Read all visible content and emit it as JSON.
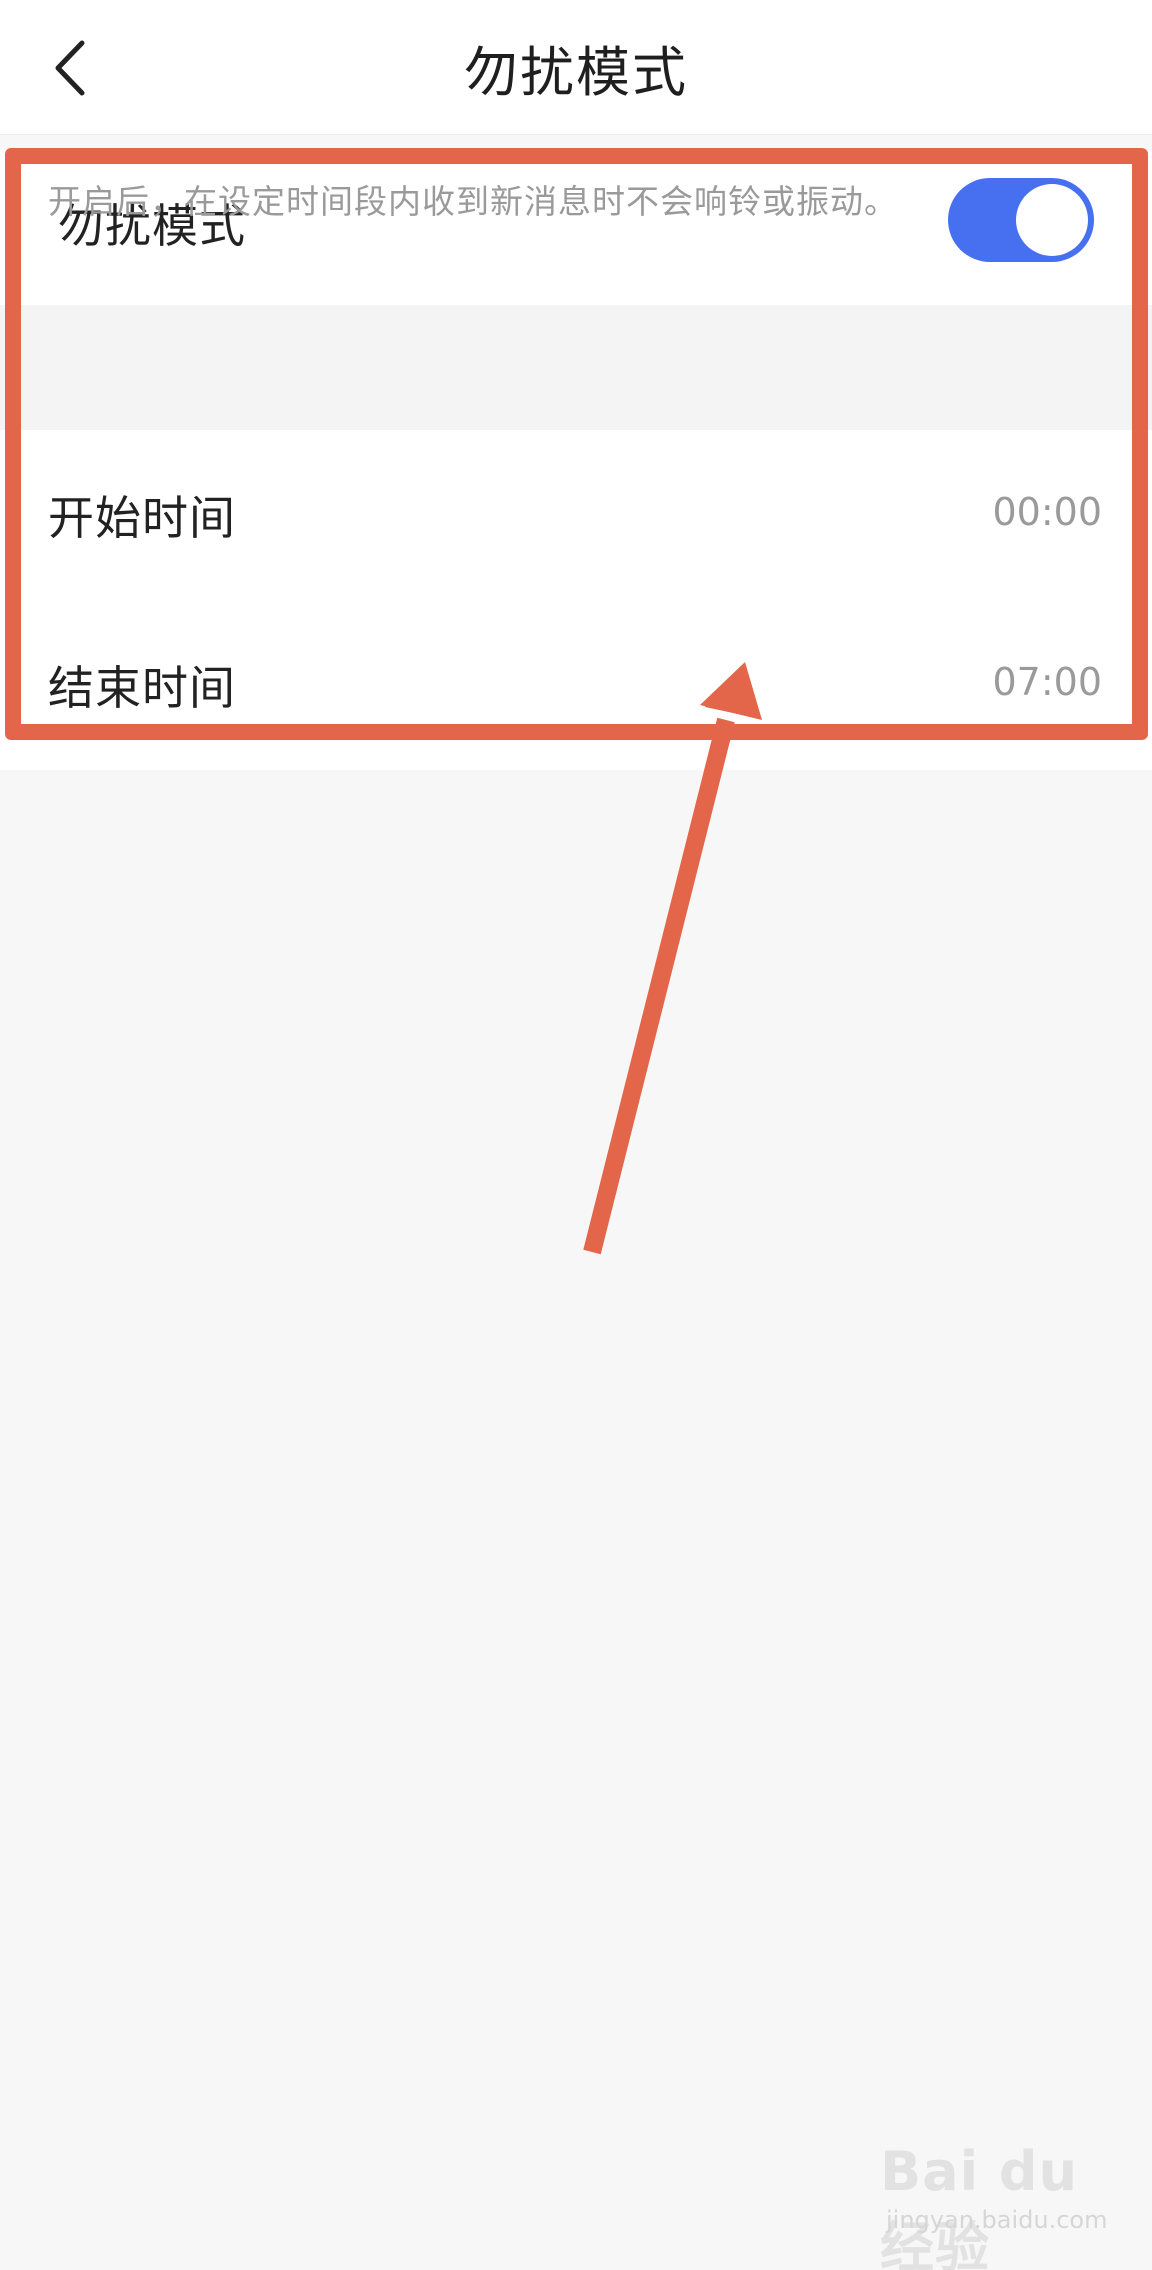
{
  "header": {
    "title": "勿扰模式",
    "back_icon": "chevron-left-icon"
  },
  "settings": {
    "dnd_label": "勿扰模式",
    "dnd_enabled": true,
    "description": "开启后，在设定时间段内收到新消息时不会响铃或振动。",
    "start_label": "开始时间",
    "start_value": "00:00",
    "end_label": "结束时间",
    "end_value": "07:00"
  },
  "colors": {
    "toggle_on": "#4670f0",
    "annotation": "#e3664b"
  },
  "watermark": {
    "brand": "Bai du 经验",
    "url": "jingyan.baidu.com"
  }
}
